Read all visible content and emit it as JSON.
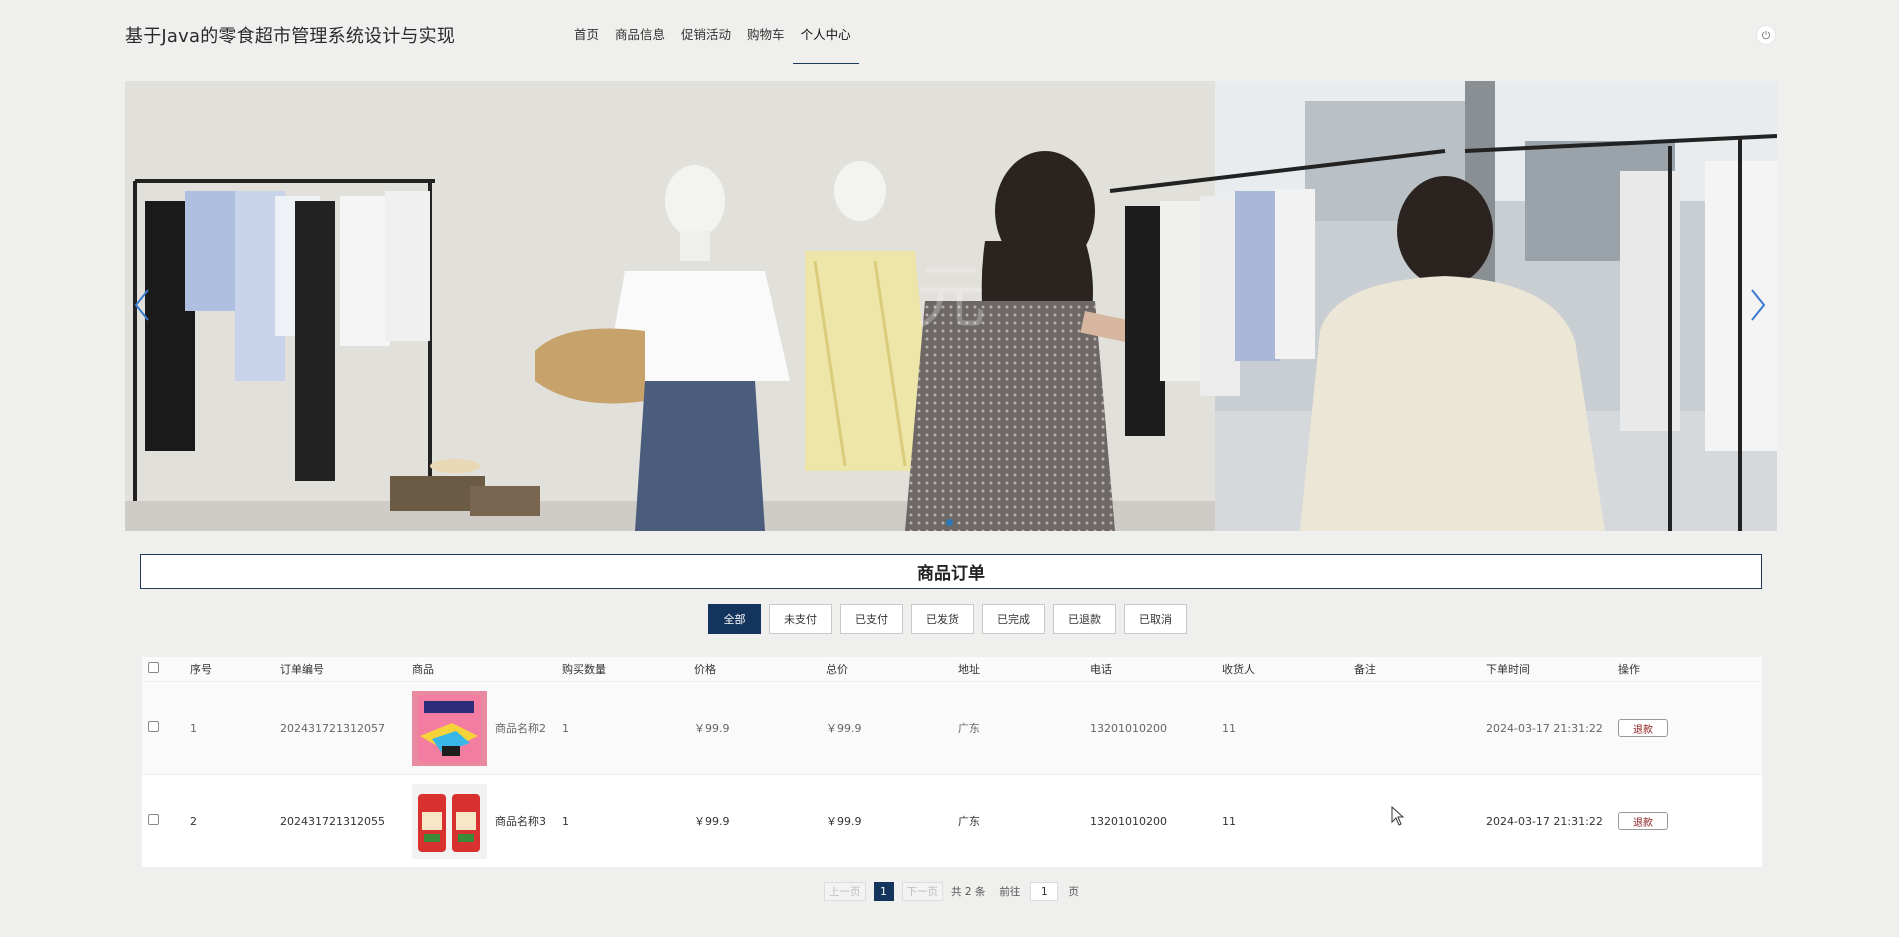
{
  "header": {
    "title": "基于Java的零食超市管理系统设计与实现",
    "nav": [
      {
        "label": "首页",
        "active": false
      },
      {
        "label": "商品信息",
        "active": false
      },
      {
        "label": "促销活动",
        "active": false
      },
      {
        "label": "购物车",
        "active": false
      },
      {
        "label": "个人中心",
        "active": true
      }
    ],
    "logout_icon": "power-icon"
  },
  "banner": {
    "image": "clothing-store-photo",
    "slides_visible": 1,
    "active_dot": 1
  },
  "section": {
    "title": "商品订单"
  },
  "filters": [
    "全部",
    "未支付",
    "已支付",
    "已发货",
    "已完成",
    "已退款",
    "已取消"
  ],
  "active_filter": "全部",
  "table": {
    "headers": [
      "序号",
      "订单编号",
      "商品",
      "购买数量",
      "价格",
      "总价",
      "地址",
      "电话",
      "收货人",
      "备注",
      "下单时间",
      "操作"
    ],
    "rows": [
      {
        "no": "1",
        "order_no": "202431721312057",
        "product": "商品名称2",
        "qty": "1",
        "price": "￥99.9",
        "total": "￥99.9",
        "address": "广东",
        "phone": "13201010200",
        "receiver": "11",
        "remark": "",
        "time": "2024-03-17 21:31:22",
        "action": "退款"
      },
      {
        "no": "2",
        "order_no": "202431721312055",
        "product": "商品名称3",
        "qty": "1",
        "price": "￥99.9",
        "total": "￥99.9",
        "address": "广东",
        "phone": "13201010200",
        "receiver": "11",
        "remark": "",
        "time": "2024-03-17 21:31:22",
        "action": "退款"
      }
    ]
  },
  "pagination": {
    "prev": "上一页",
    "current": "1",
    "next": "下一页",
    "total": "共 2 条",
    "goto": "前往",
    "page_input": "1",
    "page_suffix": "页"
  },
  "colors": {
    "primary": "#13345c",
    "background": "#efefed",
    "refund": "#8b1a1a"
  }
}
